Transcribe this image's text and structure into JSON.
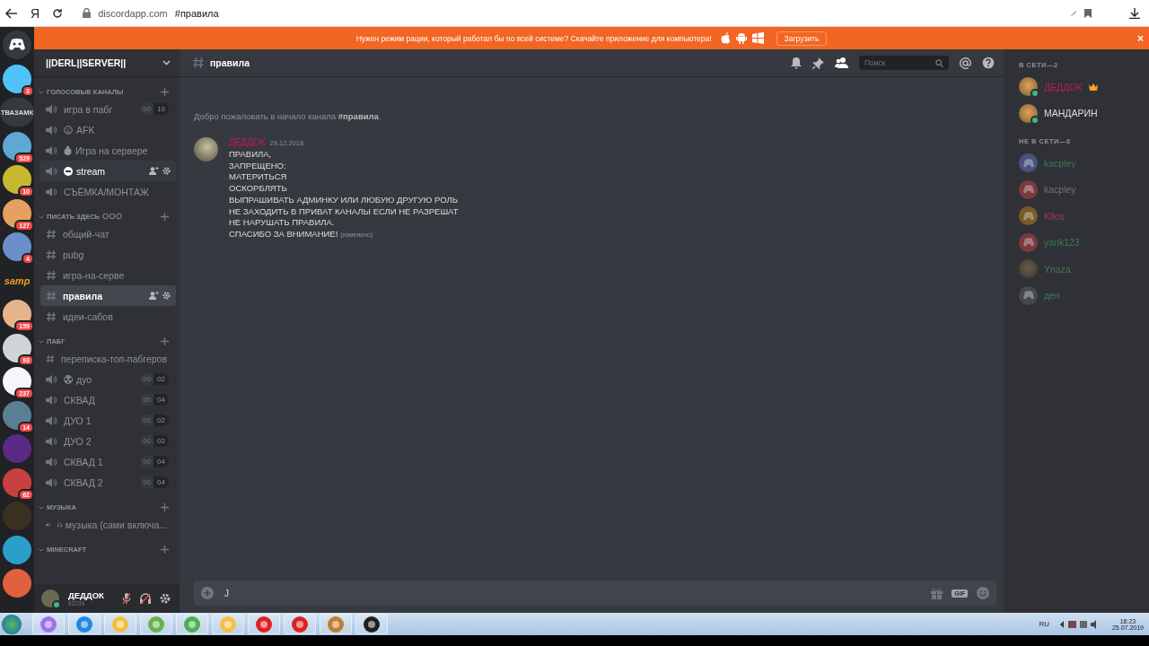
{
  "browser": {
    "letter": "Я",
    "domain": "discordapp.com",
    "page_title": "#правила"
  },
  "banner": {
    "text": "Нужен режим рации, который работал бы по всей системе? Скачайте приложение для компьютера!",
    "button": "Загрузить",
    "close": "×"
  },
  "servers": [
    {
      "kind": "home",
      "color": "#36393f"
    },
    {
      "kind": "avatar",
      "color": "#4fc3f7",
      "badge": "3"
    },
    {
      "kind": "text",
      "label": "ТВАЗАМК",
      "color": "#36393f"
    },
    {
      "kind": "avatar",
      "color": "#5fa8d3",
      "badge": "529"
    },
    {
      "kind": "avatar",
      "color": "#c8b830",
      "badge": "10"
    },
    {
      "kind": "avatar",
      "color": "#e8a060",
      "badge": "127"
    },
    {
      "kind": "avatar",
      "color": "#6a8fc8",
      "badge": "4"
    },
    {
      "kind": "logo",
      "label": "samp",
      "color": "#202225"
    },
    {
      "kind": "avatar",
      "color": "#e6b48a",
      "badge": "159"
    },
    {
      "kind": "avatar",
      "color": "#d0d4d8",
      "badge": "93"
    },
    {
      "kind": "avatar",
      "color": "#f4f6fa",
      "badge": "237"
    },
    {
      "kind": "avatar",
      "color": "#5a7e94",
      "badge": "14"
    },
    {
      "kind": "avatar",
      "color": "#5b2a86"
    },
    {
      "kind": "avatar",
      "color": "#c84040",
      "badge": "62"
    },
    {
      "kind": "avatar",
      "color": "#3a3020"
    },
    {
      "kind": "avatar",
      "color": "#2aa0c8"
    },
    {
      "kind": "avatar",
      "color": "#e06040"
    }
  ],
  "server": {
    "name": "||DERL||SERVER||"
  },
  "categories": [
    {
      "name": "ГОЛОСОВЫЕ КАНАЛЫ",
      "channels": [
        {
          "kind": "voice",
          "name": "игра в пабг",
          "limit": [
            "00",
            "10"
          ],
          "selected": false,
          "hovered": false
        },
        {
          "kind": "voice",
          "emoji": {
            "kind": "face"
          },
          "name": "AFK",
          "selected": false,
          "hovered": false
        },
        {
          "kind": "voice",
          "emoji": {
            "kind": "bag"
          },
          "name": "Игра на сервере",
          "selected": false,
          "hovered": false
        },
        {
          "kind": "voice",
          "emoji": {
            "kind": "noentry"
          },
          "name": "stream",
          "selected": false,
          "hovered": true
        },
        {
          "kind": "voice",
          "name": "СЪЁМКА/МОНТАЖ",
          "selected": false,
          "hovered": false
        }
      ]
    },
    {
      "name": "ПИСАТЬ ЗДЕСЬ",
      "emoji": {
        "kind": "bubbles"
      },
      "channels": [
        {
          "kind": "text",
          "name": "общий-чат",
          "selected": false,
          "hovered": false
        },
        {
          "kind": "text",
          "name": "pubg",
          "selected": false,
          "hovered": false
        },
        {
          "kind": "text",
          "name": "игра-на-серве",
          "selected": false,
          "hovered": false
        },
        {
          "kind": "text",
          "name": "правила",
          "selected": true,
          "hovered": false
        },
        {
          "kind": "text",
          "name": "идеи-сабов",
          "selected": false,
          "hovered": false
        }
      ]
    },
    {
      "name": "ПАБГ",
      "channels": [
        {
          "kind": "text",
          "name": "переписка-топ-пабгеров",
          "selected": false,
          "hovered": false
        },
        {
          "kind": "voice",
          "emoji": {
            "kind": "radiation"
          },
          "name": "дуо",
          "limit": [
            "00",
            "02"
          ],
          "selected": false,
          "hovered": false
        },
        {
          "kind": "voice",
          "name": "СКВАД",
          "limit": [
            "00",
            "04"
          ],
          "selected": false,
          "hovered": false
        },
        {
          "kind": "voice",
          "name": "ДУО 1",
          "limit": [
            "00",
            "02"
          ],
          "selected": false,
          "hovered": false
        },
        {
          "kind": "voice",
          "name": "ДУО 2",
          "limit": [
            "00",
            "02"
          ],
          "selected": false,
          "hovered": false
        },
        {
          "kind": "voice",
          "name": "СКВАД 1",
          "limit": [
            "00",
            "04"
          ],
          "selected": false,
          "hovered": false
        },
        {
          "kind": "voice",
          "name": "СКВАД 2",
          "limit": [
            "00",
            "04"
          ],
          "selected": false,
          "hovered": false
        }
      ]
    },
    {
      "name": "МУЗЫКА",
      "channels": [
        {
          "kind": "voice",
          "emoji": {
            "kind": "headphones"
          },
          "name": "музыка (сами включа...",
          "selected": false,
          "hovered": false
        }
      ]
    },
    {
      "name": "MINECRAFT"
    }
  ],
  "user": {
    "name": "ДЕДДОК",
    "tag": "#3239",
    "mic_muted": true,
    "sound_muted": true
  },
  "channel_header": {
    "name": "правила",
    "search_placeholder": "Поиск"
  },
  "welcome": "Добро пожаловать в начало канала **#правила**.",
  "message": {
    "author": {
      "name": "ДЕДДОК",
      "color": "#c2185b"
    },
    "time": "29.12.2018",
    "lines": [
      "ПРАВИЛА,",
      "ЗАПРЕЩЕНО:",
      "МАТЕРИТЬСЯ",
      "ОСКОРБЛЯТЬ",
      "ВЫПРАШИВАТЬ АДМИНКУ ИЛИ ЛЮБУЮ ДРУГУЮ РОЛЬ",
      "НЕ ЗАХОДИТЬ В ПРИВАТ КАНАЛЫ ЕСЛИ НЕ РАЗРЕШАТ",
      "НЕ НАРУШАТЬ ПРАВИЛА.",
      "СПАСИБО ЗА ВНИМАНИЕ!"
    ],
    "edited": "(изменено)"
  },
  "composer": {
    "value": "J",
    "gif": "GIF"
  },
  "members": [
    {
      "heading": "В СЕТИ—2",
      "people": [
        {
          "name": "ДЕДДОК",
          "color": "#c2185b",
          "avatar": {
            "kind": "photo"
          },
          "online": true,
          "owner": true
        },
        {
          "name": "МАНДАРИН",
          "color": "#dcddde",
          "avatar": {
            "kind": "photo"
          },
          "online": true,
          "owner": false
        }
      ]
    },
    {
      "heading": "НЕ В СЕТИ—6",
      "people": [
        {
          "name": "kacpley",
          "color": "#3d7a55",
          "avatar": {
            "kind": "default",
            "color": "#4a5180"
          },
          "online": false,
          "owner": false
        },
        {
          "name": "kacpley",
          "color": "#6f7278",
          "avatar": {
            "kind": "default",
            "color": "#7a3a3e"
          },
          "online": false,
          "owner": false
        },
        {
          "name": "Kilos",
          "color": "#a83262",
          "avatar": {
            "kind": "default",
            "color": "#7a5a28"
          },
          "online": false,
          "owner": false
        },
        {
          "name": "yarik123",
          "color": "#3d7a55",
          "avatar": {
            "kind": "default",
            "color": "#7a3a3e"
          },
          "online": false,
          "owner": false
        },
        {
          "name": "Ynaza",
          "color": "#3d7a55",
          "avatar": {
            "kind": "photo"
          },
          "online": false,
          "owner": false
        },
        {
          "name": "ден",
          "color": "#3d7a55",
          "avatar": {
            "kind": "default",
            "color": "#45484e"
          },
          "online": false,
          "owner": false
        }
      ]
    }
  ],
  "taskbar": {
    "apps": [
      {
        "color": "#a070f0"
      },
      {
        "color": "#1e88e5"
      },
      {
        "color": "#f0c040"
      },
      {
        "color": "#6ab04c"
      },
      {
        "color": "#4caf50"
      },
      {
        "color": "#f6c042"
      },
      {
        "color": "#e02020"
      },
      {
        "color": "#e02020"
      },
      {
        "color": "#c08030"
      },
      {
        "color": "#202020"
      }
    ],
    "language": "RU",
    "time": "18:23",
    "date": "25.07.2019"
  }
}
